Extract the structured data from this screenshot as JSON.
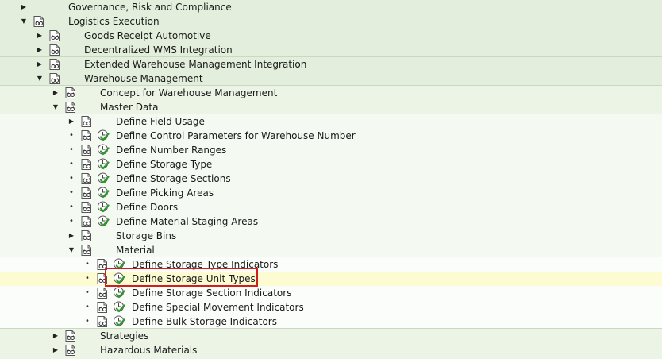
{
  "tree": {
    "governance_risk_compliance": "Governance, Risk and Compliance",
    "logistics_execution": "Logistics Execution",
    "goods_receipt_automotive": "Goods Receipt Automotive",
    "decentralized_wms_integration": "Decentralized WMS Integration",
    "extended_wm_integration": "Extended Warehouse Management Integration",
    "warehouse_management": "Warehouse Management",
    "concept_for_wm": "Concept for Warehouse Management",
    "master_data": "Master Data",
    "define_field_usage": "Define Field Usage",
    "define_control_parameters": "Define Control Parameters for Warehouse Number",
    "define_number_ranges": "Define Number Ranges",
    "define_storage_type": "Define Storage Type",
    "define_storage_sections": "Define Storage Sections",
    "define_picking_areas": "Define Picking Areas",
    "define_doors": "Define Doors",
    "define_material_staging_areas": "Define Material Staging Areas",
    "storage_bins": "Storage Bins",
    "material": "Material",
    "define_storage_type_indicators": "Define Storage Type Indicators",
    "define_storage_unit_types": "Define Storage Unit Types",
    "define_storage_section_indicators": "Define Storage Section Indicators",
    "define_special_movement_indicators": "Define Special Movement Indicators",
    "define_bulk_storage_indicators": "Define Bulk Storage Indicators",
    "strategies": "Strategies",
    "hazardous_materials": "Hazardous Materials"
  },
  "icons": {
    "expand": "collapsed-triangle-icon",
    "collapse": "expanded-triangle-icon",
    "documentation": "documentation-glasses-icon",
    "execute": "execute-clock-check-icon"
  },
  "colors": {
    "level1": "#e3efdc",
    "level2": "#ecf4e6",
    "level3": "#f4f9f1",
    "level4": "#fbfdfa",
    "selected": "#fdfbd2",
    "highlight_border": "#d01f1f",
    "check_green": "#2e9a2e"
  }
}
